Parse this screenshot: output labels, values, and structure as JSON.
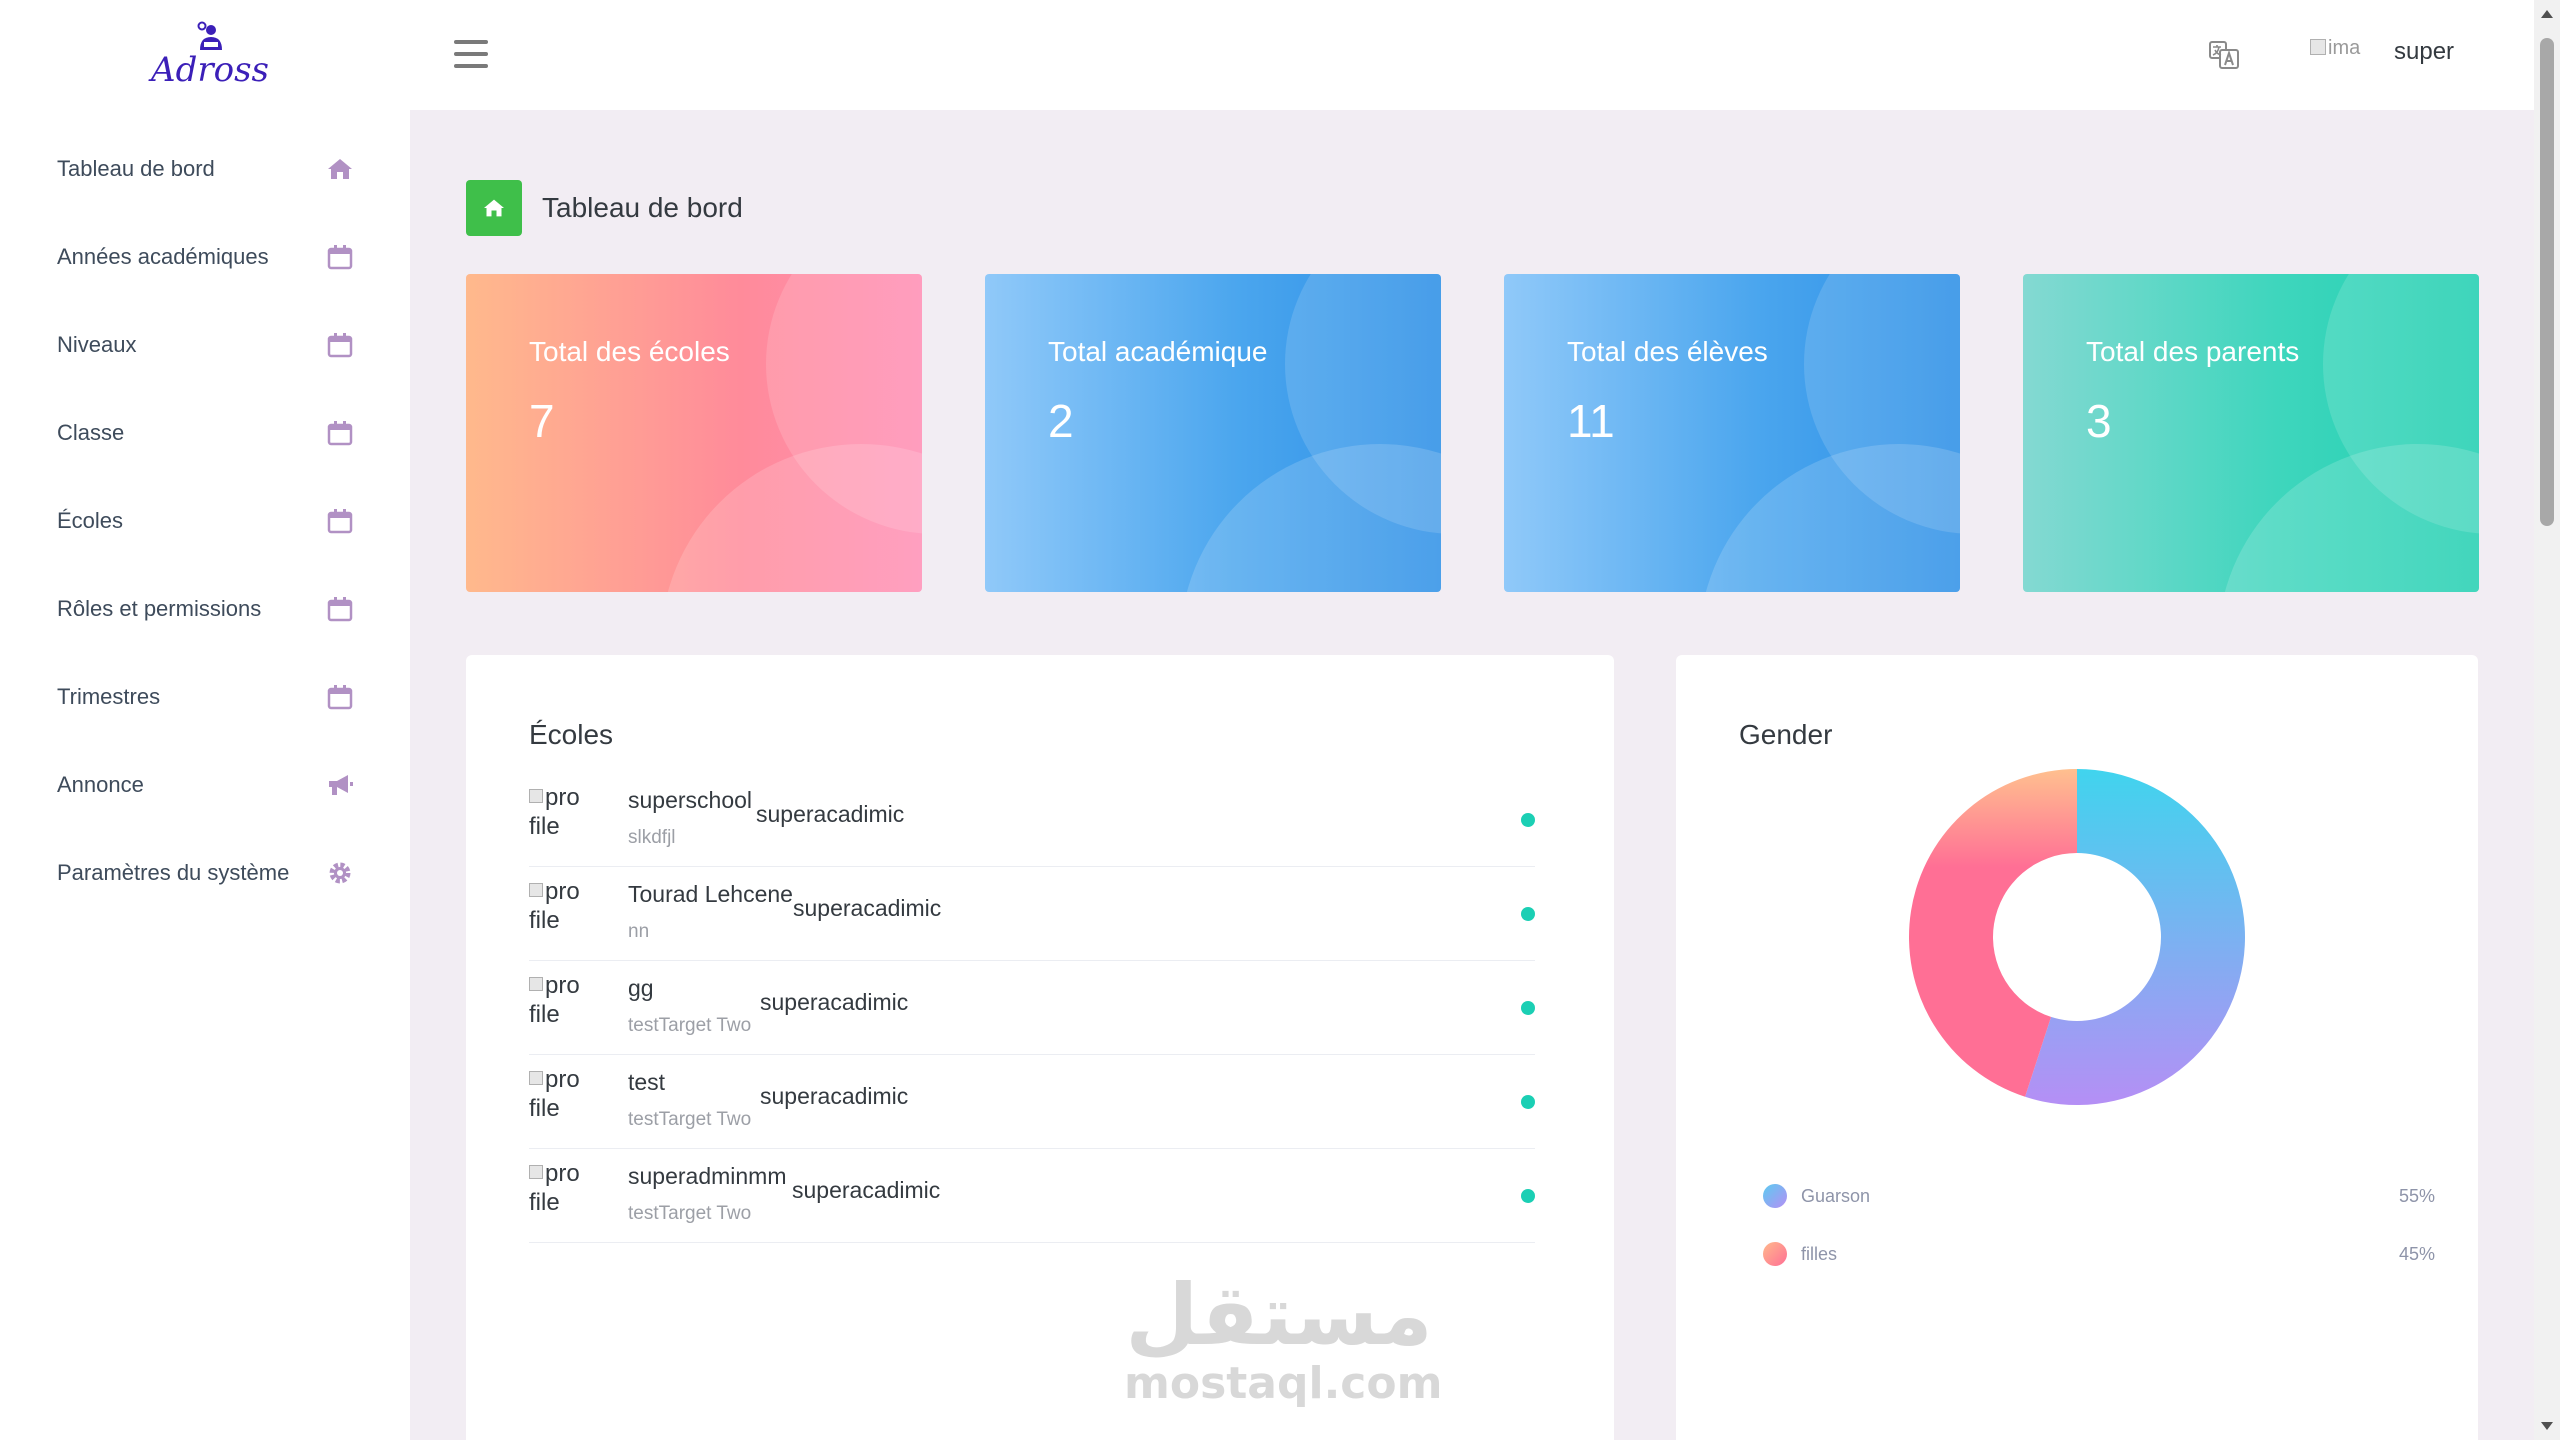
{
  "sidebar": {
    "logo_text": "Adross",
    "items": [
      {
        "label": "Tableau de bord",
        "icon": "home-icon"
      },
      {
        "label": "Années académiques",
        "icon": "calendar-icon"
      },
      {
        "label": "Niveaux",
        "icon": "calendar-icon"
      },
      {
        "label": "Classe",
        "icon": "calendar-icon"
      },
      {
        "label": "Écoles",
        "icon": "calendar-icon"
      },
      {
        "label": "Rôles et permissions",
        "icon": "calendar-icon"
      },
      {
        "label": "Trimestres",
        "icon": "calendar-icon"
      },
      {
        "label": "Annonce",
        "icon": "megaphone-icon"
      },
      {
        "label": "Paramètres du système",
        "icon": "gear-icon"
      }
    ],
    "icon_color": "#b191c4"
  },
  "topbar": {
    "avatar_alt": "ima",
    "username": "super"
  },
  "page": {
    "title": "Tableau de bord"
  },
  "stats": [
    {
      "label": "Total des écoles",
      "value": "7"
    },
    {
      "label": "Total académique",
      "value": "2"
    },
    {
      "label": "Total des élèves",
      "value": "11"
    },
    {
      "label": "Total des parents",
      "value": "3"
    }
  ],
  "schools": {
    "title": "Écoles",
    "img_alt": "pro file",
    "rows": [
      {
        "name": "superschool",
        "sub": "slkdfjl",
        "academic": "superacadimic"
      },
      {
        "name": "Tourad Lehcene",
        "sub": "nn",
        "academic": "superacadimic"
      },
      {
        "name": "gg",
        "sub": "testTarget Two",
        "academic": "superacadimic"
      },
      {
        "name": "test",
        "sub": "testTarget Two",
        "academic": "superacadimic"
      },
      {
        "name": "superadminmm",
        "sub": "testTarget Two",
        "academic": "superacadimic"
      }
    ],
    "status_color": "#1bcfb4"
  },
  "gender": {
    "title": "Gender",
    "legend": [
      {
        "name": "Guarson",
        "value": "55%"
      },
      {
        "name": "filles",
        "value": "45%"
      }
    ]
  },
  "chart_data": {
    "type": "pie",
    "title": "Gender",
    "categories": [
      "Guarson",
      "filles"
    ],
    "values": [
      55,
      45
    ],
    "colors": [
      "#5ccbf0",
      "#ff6f95"
    ],
    "donut": true
  },
  "watermark": {
    "ar": "مستقل",
    "en": "mostaql.com"
  }
}
